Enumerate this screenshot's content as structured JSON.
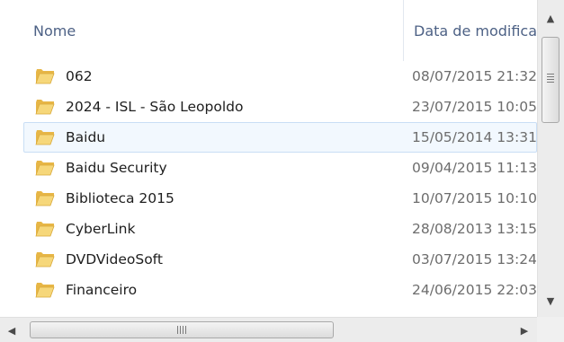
{
  "columns": {
    "name": "Nome",
    "date": "Data de modificação"
  },
  "rows": [
    {
      "name": "062",
      "date": "08/07/2015 21:32"
    },
    {
      "name": "2024 - ISL - São Leopoldo",
      "date": "23/07/2015 10:05"
    },
    {
      "name": "Baidu",
      "date": "15/05/2014 13:31"
    },
    {
      "name": "Baidu Security",
      "date": "09/04/2015 11:13"
    },
    {
      "name": "Biblioteca 2015",
      "date": "10/07/2015 10:10"
    },
    {
      "name": "CyberLink",
      "date": "28/08/2013 13:15"
    },
    {
      "name": "DVDVideoSoft",
      "date": "03/07/2015 13:24"
    },
    {
      "name": "Financeiro",
      "date": "24/06/2015 22:03"
    }
  ],
  "hovered_row": "Baidu",
  "icons": {
    "folder": "folder-icon",
    "scroll_up": "scroll-up-arrow-icon",
    "scroll_down": "scroll-down-arrow-icon",
    "scroll_left": "scroll-left-arrow-icon",
    "scroll_right": "scroll-right-arrow-icon"
  },
  "colors": {
    "header_text": "#4d6185",
    "hover_background": "#f2f8fe",
    "hover_border": "#c9def5",
    "folder_yellow": "#f3cf6c"
  }
}
